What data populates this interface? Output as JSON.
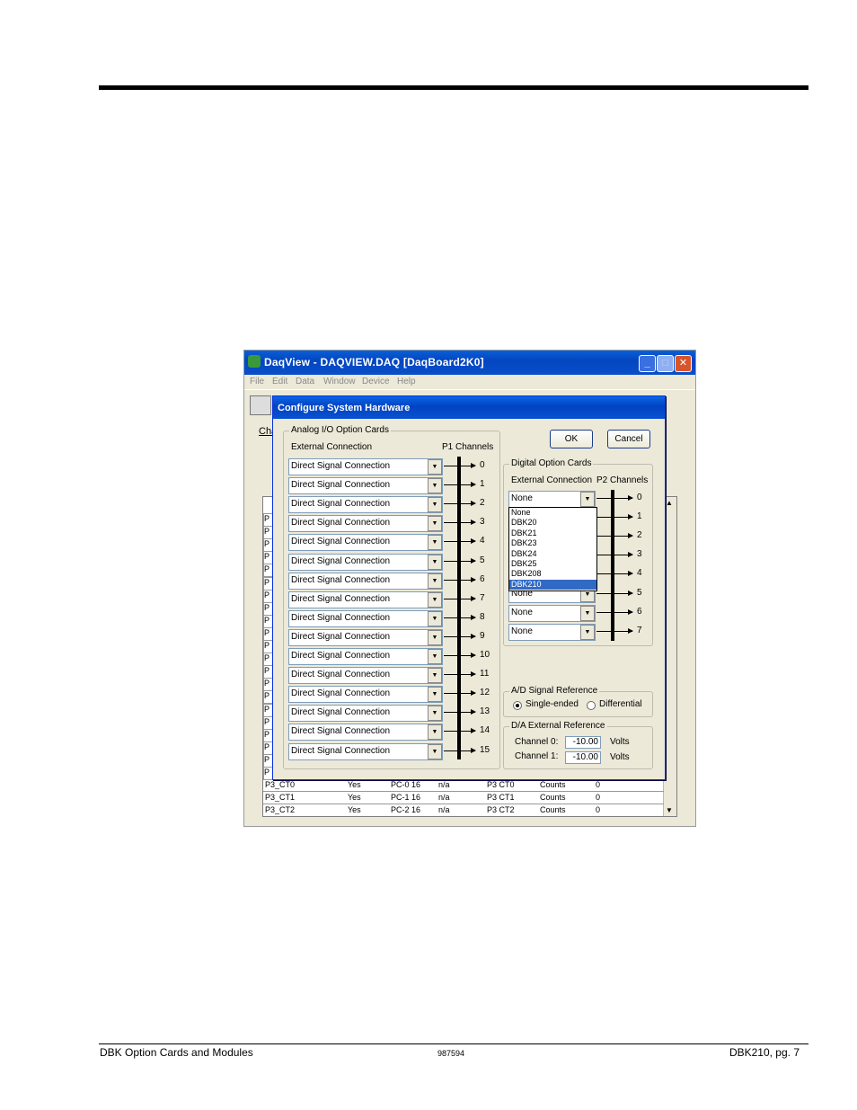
{
  "footer": {
    "left": "DBK Option Cards and Modules",
    "center": "987594",
    "right": "DBK210, pg.  7"
  },
  "app": {
    "title": "DaqView - DAQVIEW.DAQ [DaqBoard2K0]",
    "menu": [
      "File",
      "Edit",
      "Data",
      "Window",
      "Device",
      "Help"
    ],
    "channels_tab": "Cha",
    "grid_rows": [
      [
        "P3_CT0",
        "Yes",
        "PC-0 16",
        "n/a",
        "P3 CT0",
        "Counts",
        "0"
      ],
      [
        "P3_CT1",
        "Yes",
        "PC-1 16",
        "n/a",
        "P3 CT1",
        "Counts",
        "0"
      ],
      [
        "P3_CT2",
        "Yes",
        "PC-2 16",
        "n/a",
        "P3 CT2",
        "Counts",
        "0"
      ]
    ],
    "row_stub": "P"
  },
  "dialog": {
    "title": "Configure System Hardware",
    "ok": "OK",
    "cancel": "Cancel",
    "analog": {
      "legend": "Analog I/O Option Cards",
      "ext_label": "External Connection",
      "ch_label": "P1 Channels",
      "value": "Direct Signal Connection",
      "channels": [
        "0",
        "1",
        "2",
        "3",
        "4",
        "5",
        "6",
        "7",
        "8",
        "9",
        "10",
        "11",
        "12",
        "13",
        "14",
        "15"
      ]
    },
    "digital": {
      "legend": "Digital Option Cards",
      "ext_label": "External Connection",
      "ch_label": "P2 Channels",
      "value": "None",
      "channels": [
        "0",
        "1",
        "2",
        "3",
        "4",
        "5",
        "6",
        "7"
      ],
      "dropdown": [
        "None",
        "DBK20",
        "DBK21",
        "DBK23",
        "DBK24",
        "DBK25",
        "DBK208",
        "DBK210"
      ],
      "selected": "DBK210"
    },
    "ad_ref": {
      "legend": "A/D Signal Reference",
      "opt1": "Single-ended",
      "opt2": "Differential",
      "selected": "Single-ended"
    },
    "da_ref": {
      "legend": "D/A External Reference",
      "ch0_label": "Channel 0:",
      "ch0_value": "-10.00",
      "ch1_label": "Channel 1:",
      "ch1_value": "-10.00",
      "unit": "Volts"
    }
  }
}
